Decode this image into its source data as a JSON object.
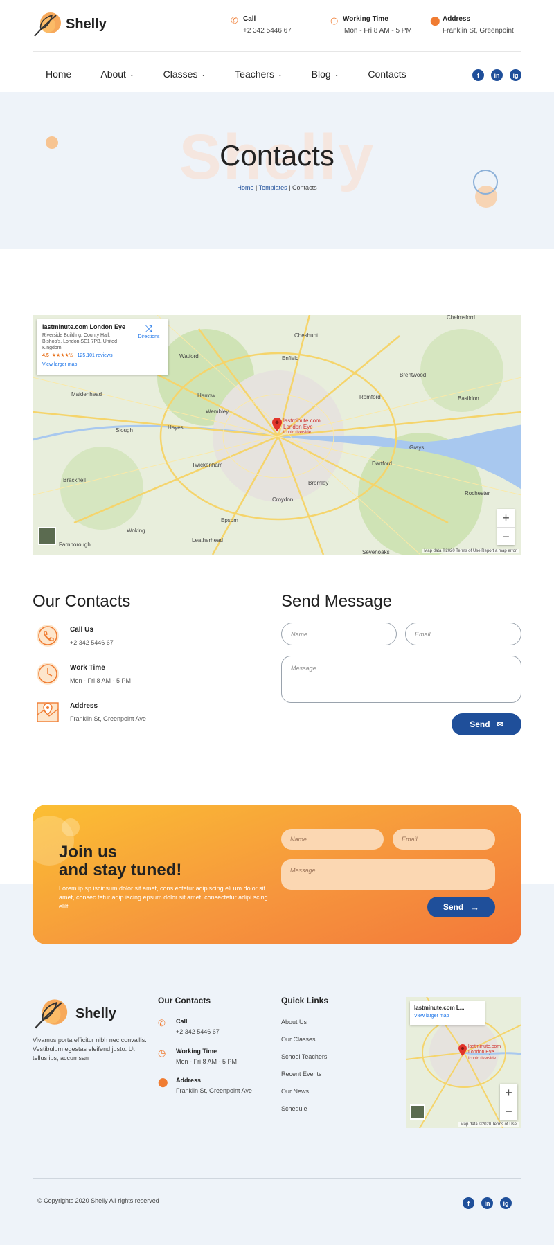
{
  "brand": {
    "name": "Shelly"
  },
  "header": {
    "call": {
      "title": "Call",
      "value": "+2 342 5446 67"
    },
    "time": {
      "title": "Working Time",
      "value": "Mon - Fri 8 AM - 5 PM"
    },
    "address": {
      "title": "Address",
      "value": "Franklin St, Greenpoint"
    }
  },
  "nav": [
    {
      "label": "Home",
      "dropdown": false
    },
    {
      "label": "About",
      "dropdown": true
    },
    {
      "label": "Classes",
      "dropdown": true
    },
    {
      "label": "Teachers",
      "dropdown": true
    },
    {
      "label": "Blog",
      "dropdown": true
    },
    {
      "label": "Contacts",
      "dropdown": false
    }
  ],
  "social": [
    "f",
    "in",
    "ig"
  ],
  "banner": {
    "ghost": "Shelly",
    "title": "Contacts",
    "crumbs": {
      "home": "Home",
      "templates": "Templates",
      "current": "Contacts",
      "sep": "|"
    }
  },
  "map": {
    "place": "lastminute.com London Eye",
    "address": "Riverside Building, County Hall, Bishop's, London SE1 7PB, United Kingdom",
    "rating": "4.5",
    "stars": "★★★★½",
    "reviews": "125,101 reviews",
    "directions": "Directions",
    "larger": "View larger map",
    "pin_label": "lastminute.com London Eye",
    "pin_sub": "Iconic riverside",
    "footer": "Map data ©2020   Terms of Use   Report a map error",
    "places": [
      "Watford",
      "Harrow",
      "Wembley",
      "Enfield",
      "Romford",
      "Slough",
      "Hayes",
      "Twickenham",
      "Croydon",
      "Bromley",
      "Dartford",
      "Epsom",
      "Woking",
      "Maidenhead",
      "Brentwood",
      "Basildon",
      "Grays",
      "Sevenoaks",
      "Chelmsford",
      "Cheshunt",
      "Rochester",
      "Leatherhead",
      "Farnborough",
      "Bracknell"
    ]
  },
  "contacts": {
    "title": "Our Contacts",
    "items": [
      {
        "title": "Call Us",
        "value": "+2 342 5446 67",
        "icon": "phone-icon"
      },
      {
        "title": "Work Time",
        "value": "Mon - Fri 8 AM - 5 PM",
        "icon": "clock-icon"
      },
      {
        "title": "Address",
        "value": "Franklin St, Greenpoint Ave",
        "icon": "map-icon"
      }
    ]
  },
  "form": {
    "title": "Send Message",
    "name_ph": "Name",
    "email_ph": "Email",
    "message_ph": "Message",
    "send": "Send"
  },
  "newsletter": {
    "line1": "Join us",
    "line2": "and stay tuned!",
    "text": "Lorem ip sp iscinsum dolor sit amet, cons ectetur adipiscing eli um dolor sit amet, consec tetur adip iscing epsum dolor sit amet, consectetur adipi scing elilt",
    "name_ph": "Name",
    "email_ph": "Email",
    "message_ph": "Message",
    "send": "Send"
  },
  "footer": {
    "brand": "Shelly",
    "desc": "Vivamus porta efficitur nibh nec convallis. Vestibulum egestas eleifend justo. Ut tellus ips, accumsan",
    "contacts_title": "Our Contacts",
    "contacts": [
      {
        "title": "Call",
        "value": "+2 342 5446 67"
      },
      {
        "title": "Working Time",
        "value": "Mon - Fri 8 AM - 5 PM"
      },
      {
        "title": "Address",
        "value": "Franklin St, Greenpoint Ave"
      }
    ],
    "links_title": "Quick Links",
    "links": [
      "About Us",
      "Our Classes",
      "School Teachers",
      "Recent Events",
      "Our News",
      "Schedule"
    ],
    "map_place": "lastminute.com L...",
    "map_larger": "View larger map",
    "map_pin": "lastminute.com London Eye",
    "map_pin_sub": "Iconic riverside",
    "map_footer": "Map data ©2020   Terms of Use",
    "copyright": "© Copyrights 2020 Shelly All rights reserved"
  },
  "colors": {
    "accent": "#f07c32",
    "primary": "#1f4f9a",
    "banner_bg": "#eef3f9"
  }
}
